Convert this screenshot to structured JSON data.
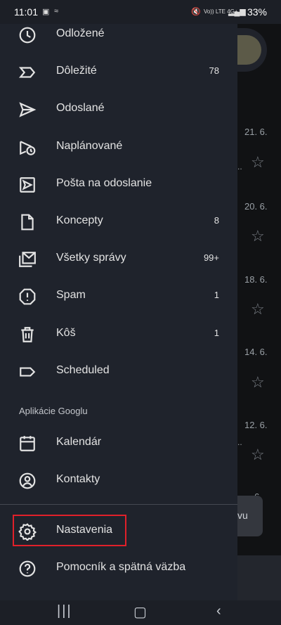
{
  "status_bar": {
    "time": "11:01",
    "network": "Vo)) LTE 4G+",
    "battery": "33%"
  },
  "drawer": {
    "items": [
      {
        "label": "Odložené",
        "icon": "clock-icon",
        "count": ""
      },
      {
        "label": "Dôležité",
        "icon": "important-label-icon",
        "count": "78"
      },
      {
        "label": "Odoslané",
        "icon": "send-icon",
        "count": ""
      },
      {
        "label": "Naplánované",
        "icon": "scheduled-send-icon",
        "count": ""
      },
      {
        "label": "Pošta na odoslanie",
        "icon": "outbox-icon",
        "count": ""
      },
      {
        "label": "Koncepty",
        "icon": "draft-file-icon",
        "count": "8"
      },
      {
        "label": "Všetky správy",
        "icon": "all-mail-icon",
        "count": "99+"
      },
      {
        "label": "Spam",
        "icon": "spam-icon",
        "count": "1"
      },
      {
        "label": "Kôš",
        "icon": "trash-icon",
        "count": "1"
      },
      {
        "label": "Scheduled",
        "icon": "label-icon",
        "count": ""
      }
    ],
    "section_apps": "Aplikácie Googlu",
    "apps": [
      {
        "label": "Kalendár",
        "icon": "calendar-icon"
      },
      {
        "label": "Kontakty",
        "icon": "contacts-icon"
      }
    ],
    "settings": {
      "label": "Nastavenia",
      "icon": "gear-icon"
    },
    "help": {
      "label": "Pomocník a spätná väzba",
      "icon": "help-icon"
    }
  },
  "background_inbox": {
    "dates": [
      "21. 6.",
      "20. 6.",
      "18. 6.",
      "14. 6.",
      "12. 6.",
      "6."
    ],
    "snackbar_text": "vu"
  },
  "colors": {
    "drawer_bg": "#1f232c",
    "highlight_border": "#e0202a"
  }
}
